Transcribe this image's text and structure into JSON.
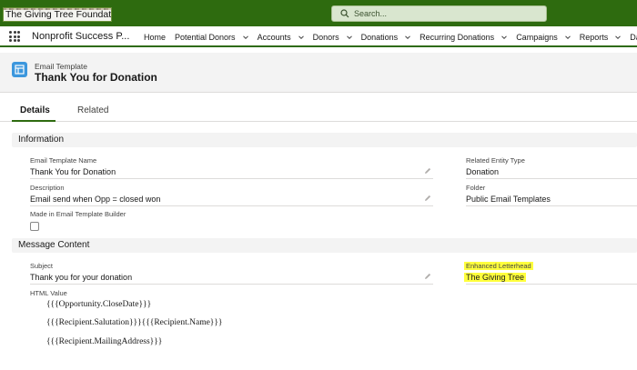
{
  "header": {
    "logo_text": "The Giving Tree Foundation",
    "search_placeholder": "Search..."
  },
  "nav": {
    "app_name": "Nonprofit Success P...",
    "items": [
      {
        "label": "Home",
        "dropdown": false
      },
      {
        "label": "Potential Donors",
        "dropdown": true
      },
      {
        "label": "Accounts",
        "dropdown": true
      },
      {
        "label": "Donors",
        "dropdown": true
      },
      {
        "label": "Donations",
        "dropdown": true
      },
      {
        "label": "Recurring Donations",
        "dropdown": true
      },
      {
        "label": "Campaigns",
        "dropdown": true
      },
      {
        "label": "Reports",
        "dropdown": true
      },
      {
        "label": "Dashb",
        "dropdown": false
      }
    ]
  },
  "record": {
    "object_type": "Email Template",
    "title": "Thank You for Donation"
  },
  "tabs": {
    "details": "Details",
    "related": "Related"
  },
  "information": {
    "heading": "Information",
    "template_name_label": "Email Template Name",
    "template_name_value": "Thank You for Donation",
    "description_label": "Description",
    "description_value": "Email send when Opp = closed won",
    "builder_label": "Made in Email Template Builder",
    "builder_checked": false,
    "related_entity_label": "Related Entity Type",
    "related_entity_value": "Donation",
    "folder_label": "Folder",
    "folder_value": "Public Email Templates"
  },
  "message": {
    "heading": "Message Content",
    "subject_label": "Subject",
    "subject_value": "Thank you for your donation",
    "letterhead_label": "Enhanced Letterhead",
    "letterhead_value": "The Giving Tree",
    "html_label": "HTML Value",
    "html_lines": [
      "{{{Opportunity.CloseDate}}}",
      "{{{Recipient.Salutation}}}{{{Recipient.Name}}}",
      "{{{Recipient.MailingAddress}}}"
    ]
  },
  "colors": {
    "brand_green": "#2e6b0f",
    "highlight": "#ffff3d",
    "object_icon": "#3c97dd"
  }
}
